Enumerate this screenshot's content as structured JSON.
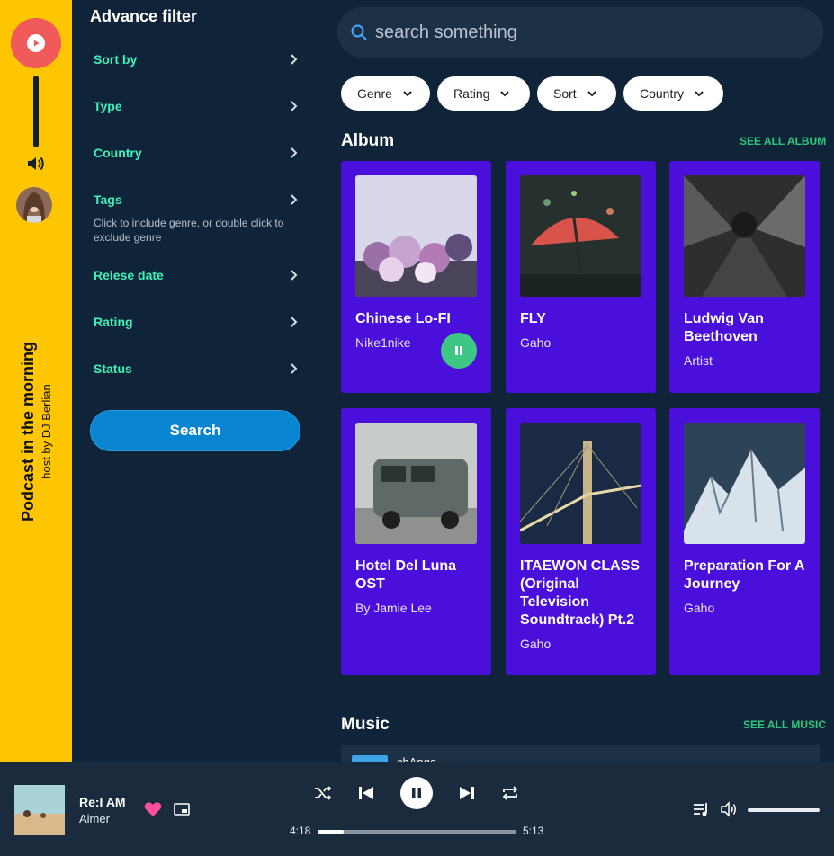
{
  "rail": {
    "podcast_title": "Podcast in the morning",
    "podcast_host": "host by DJ Berlian"
  },
  "filters": {
    "title": "Advance filter",
    "items": [
      {
        "label": "Sort by"
      },
      {
        "label": "Type"
      },
      {
        "label": "Country"
      },
      {
        "label": "Tags"
      },
      {
        "label": "Relese date"
      },
      {
        "label": "Rating"
      },
      {
        "label": "Status"
      }
    ],
    "tags_hint": "Click to include genre, or double click to exclude genre",
    "search_button": "Search"
  },
  "search": {
    "placeholder": "search something"
  },
  "chips": [
    {
      "label": "Genre"
    },
    {
      "label": "Rating"
    },
    {
      "label": "Sort"
    },
    {
      "label": "Country"
    }
  ],
  "album": {
    "title": "Album",
    "see_all": "SEE ALL ALBUM",
    "cards": [
      {
        "title": "Chinese Lo-FI",
        "subtitle": "Nike1nike",
        "playing": true
      },
      {
        "title": "FLY",
        "subtitle": "Gaho"
      },
      {
        "title": "Ludwig Van Beethoven",
        "subtitle": "Artist"
      },
      {
        "title": "Hotel Del Luna OST",
        "subtitle": "By Jamie Lee"
      },
      {
        "title": "ITAEWON CLASS (Original Television Soundtrack) Pt.2",
        "subtitle": "Gaho"
      },
      {
        "title": "Preparation For A Journey",
        "subtitle": "Gaho"
      }
    ]
  },
  "music": {
    "title": "Music",
    "see_all": "SEE ALL MUSIC",
    "first_item": "chAnge"
  },
  "player": {
    "song": "Re:I AM",
    "artist": "Aimer",
    "elapsed": "4:18",
    "duration": "5:13",
    "progress_fraction": 0.13,
    "liked": true
  },
  "colors": {
    "rail": "#fec601",
    "accent_green": "#3ef0b9",
    "card": "#4b0fdb",
    "see_all": "#2ec67a",
    "play_fab": "#f05a5a",
    "heart": "#ff4f9a"
  }
}
